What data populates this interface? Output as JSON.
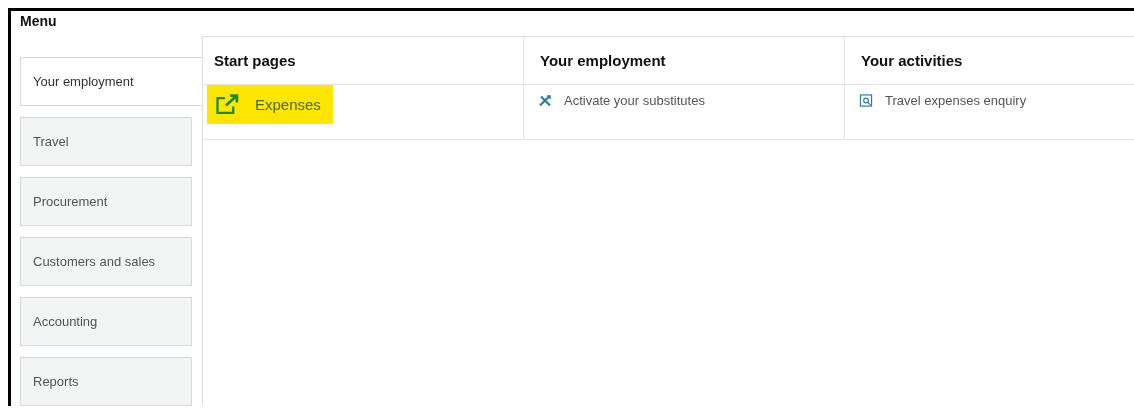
{
  "title": "Menu",
  "tabs": [
    {
      "label": "Your employment",
      "selected": true
    },
    {
      "label": "Travel",
      "selected": false
    },
    {
      "label": "Procurement",
      "selected": false
    },
    {
      "label": "Customers and sales",
      "selected": false
    },
    {
      "label": "Accounting",
      "selected": false
    },
    {
      "label": "Reports",
      "selected": false
    }
  ],
  "columns": [
    {
      "heading": "Start pages",
      "items": [
        {
          "label": "Expenses",
          "kind": "external",
          "highlighted": true
        }
      ]
    },
    {
      "heading": "Your employment",
      "items": [
        {
          "label": "Activate your substitutes",
          "kind": "tools",
          "highlighted": false
        }
      ]
    },
    {
      "heading": "Your activities",
      "items": [
        {
          "label": "Travel expenses enquiry",
          "kind": "enquiry",
          "highlighted": false
        }
      ]
    }
  ]
}
